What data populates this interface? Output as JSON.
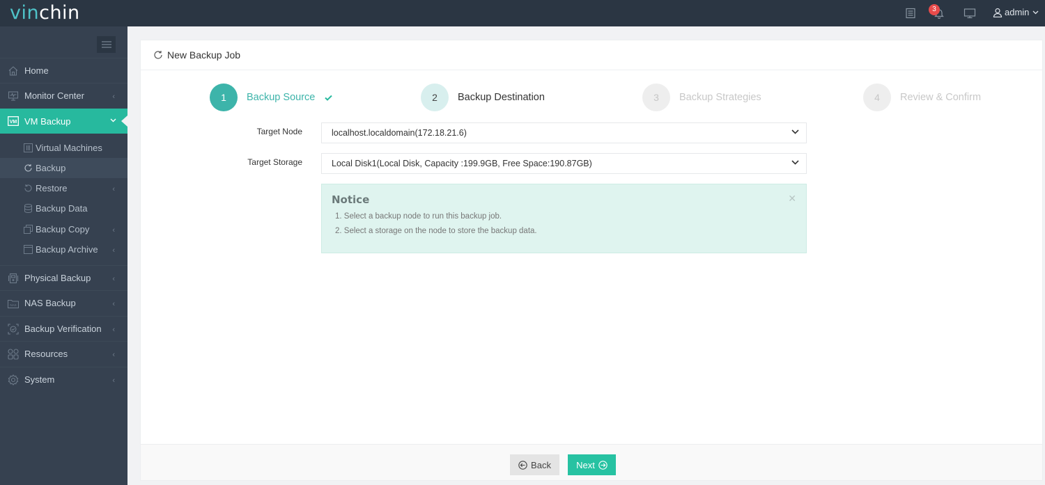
{
  "app": {
    "logo_part1": "vin",
    "logo_part2": "chin"
  },
  "topbar": {
    "notification_count": "3",
    "user": "admin"
  },
  "sidebar": {
    "items": [
      {
        "label": "Home",
        "icon": "home-icon"
      },
      {
        "label": "Monitor Center",
        "icon": "monitor-icon"
      },
      {
        "label": "VM Backup",
        "icon": "vm-icon",
        "active": true
      },
      {
        "label": "Physical Backup",
        "icon": "physical-server-icon"
      },
      {
        "label": "NAS Backup",
        "icon": "nas-icon"
      },
      {
        "label": "Backup Verification",
        "icon": "verification-icon"
      },
      {
        "label": "Resources",
        "icon": "resources-icon"
      },
      {
        "label": "System",
        "icon": "gear-icon"
      }
    ],
    "subitems": [
      {
        "label": "Virtual Machines",
        "icon": "virtual-machines-icon"
      },
      {
        "label": "Backup",
        "icon": "refresh-icon",
        "current": true
      },
      {
        "label": "Restore",
        "icon": "restore-icon"
      },
      {
        "label": "Backup Data",
        "icon": "database-icon"
      },
      {
        "label": "Backup Copy",
        "icon": "copy-icon"
      },
      {
        "label": "Backup Archive",
        "icon": "archive-icon"
      }
    ]
  },
  "panel": {
    "title": "New Backup Job"
  },
  "steps": [
    {
      "number": "1",
      "label": "Backup Source",
      "state": "done"
    },
    {
      "number": "2",
      "label": "Backup Destination",
      "state": "current"
    },
    {
      "number": "3",
      "label": "Backup Strategies",
      "state": "todo"
    },
    {
      "number": "4",
      "label": "Review & Confirm",
      "state": "todo"
    }
  ],
  "form": {
    "target_node_label": "Target Node",
    "target_node_value": "localhost.localdomain(172.18.21.6)",
    "target_storage_label": "Target Storage",
    "target_storage_value": "Local Disk1(Local Disk, Capacity :199.9GB, Free Space:190.87GB)"
  },
  "notice": {
    "title": "Notice",
    "lines": [
      "1. Select a backup node to run this backup job.",
      "2. Select a storage on the node to store the backup data."
    ]
  },
  "footer": {
    "back_label": "Back",
    "next_label": "Next"
  },
  "colors": {
    "accent": "#27b99e",
    "topbar": "#2b3643",
    "sidebar": "#364150",
    "badge": "#e84b4b",
    "notice_bg": "#dff4ef"
  }
}
